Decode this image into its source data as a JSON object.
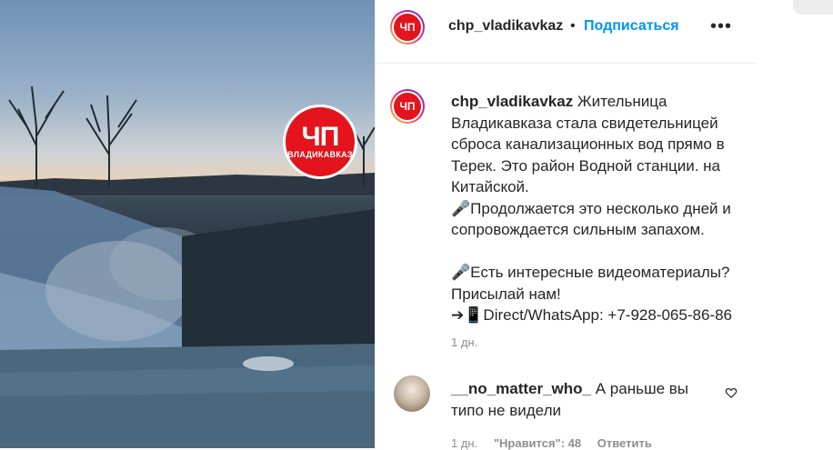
{
  "media": {
    "logo_big": "ЧП",
    "logo_small": "ВЛАДИКАВКАЗ"
  },
  "header": {
    "avatar_text": "ЧП",
    "username": "chp_vladikavkaz",
    "separator": "•",
    "follow_label": "Подписаться",
    "more_label": "•••"
  },
  "caption": {
    "avatar_text": "ЧП",
    "username": "chp_vladikavkaz",
    "text": " Жительница Владикавказа стала свидетельницей сброса канализационных вод прямо в Терек. Это район Водной станции. на Китайской.\n🎤Продолжается это несколько дней и сопровождается сильным запахом.\n\n🎤Есть интересные видеоматериалы? Присылай нам!\n➔📱Direct/WhatsApp: +7-928-065-86-86",
    "time": "1 дн."
  },
  "comment": {
    "username": "__no_matter_who_",
    "text": " А раньше вы типо не видели",
    "time": "1 дн.",
    "likes": "\"Нравится\": 48",
    "reply_label": "Ответить",
    "heart_icon": "heart-outline-icon"
  }
}
